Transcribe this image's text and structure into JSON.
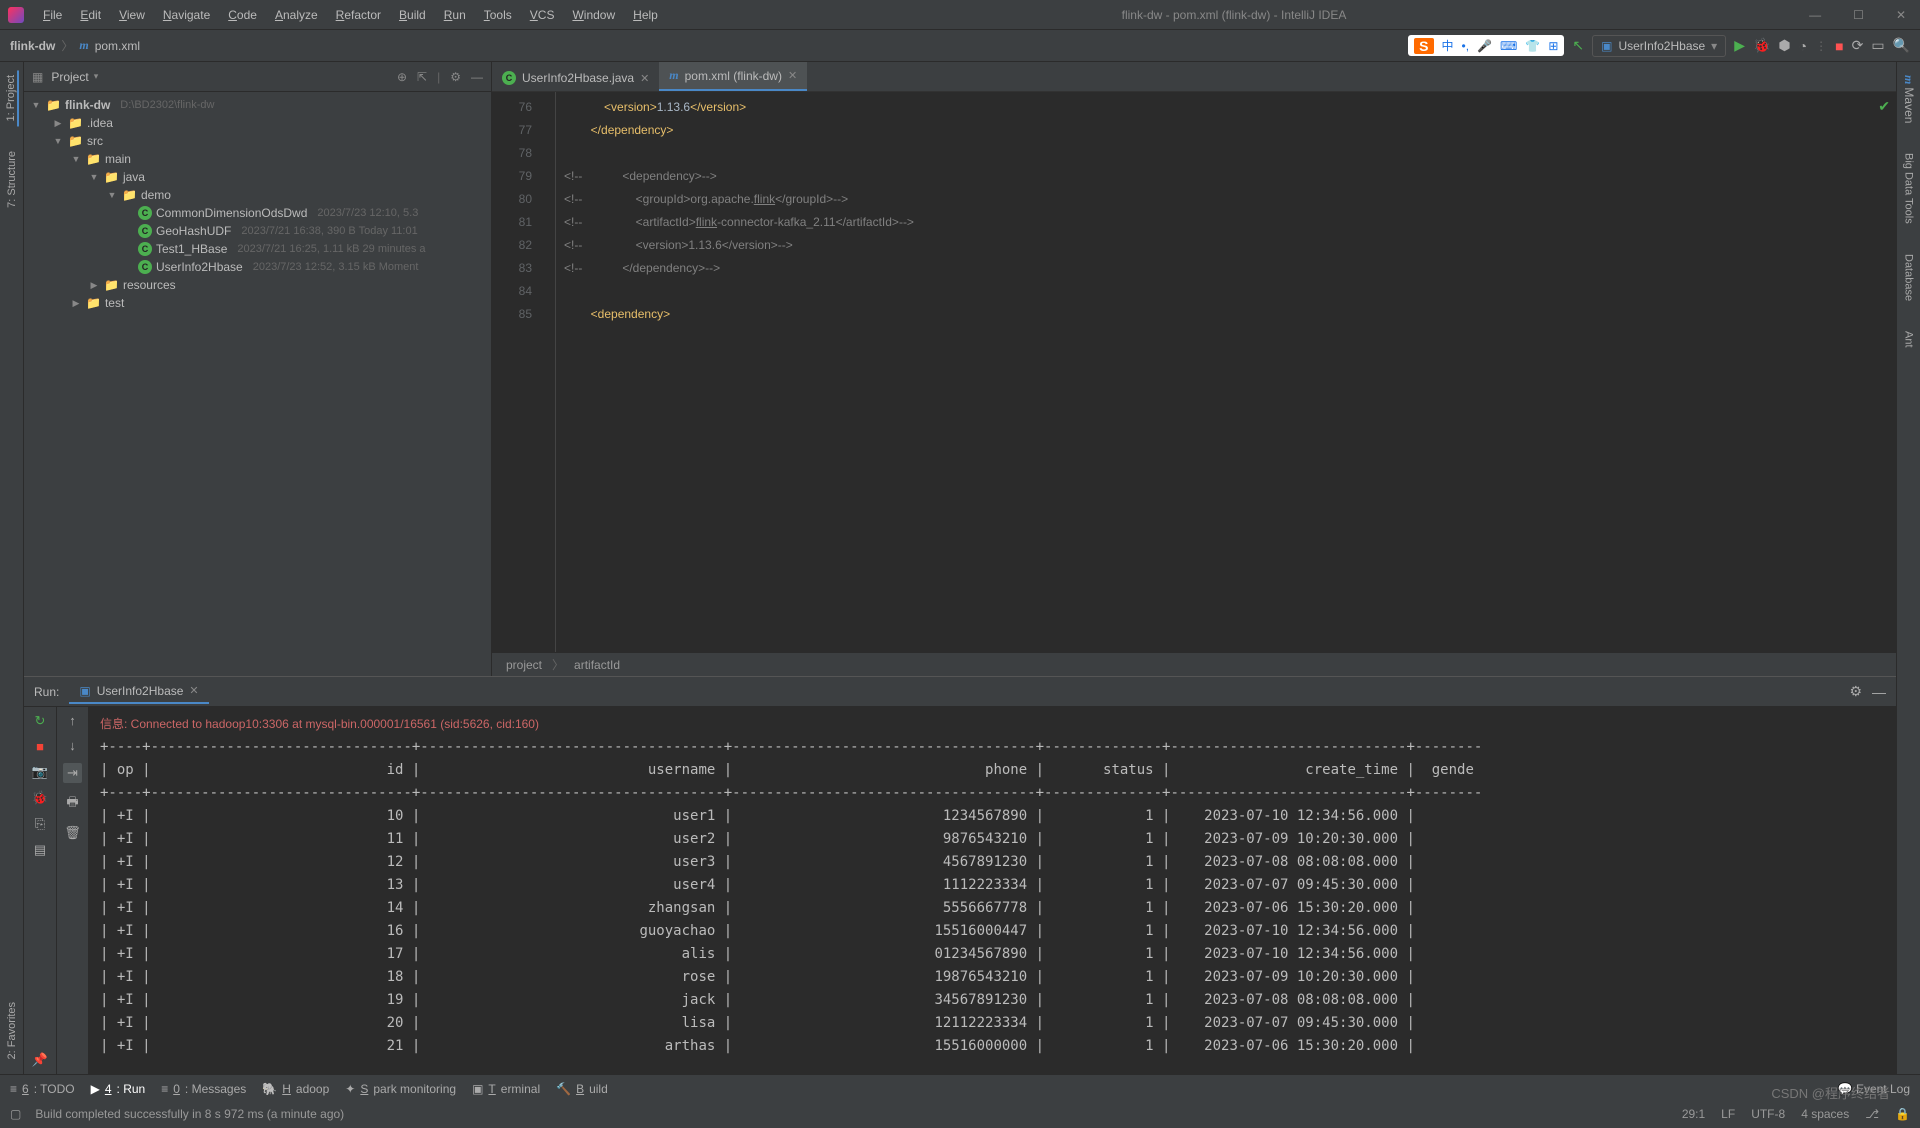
{
  "window": {
    "title": "flink-dw - pom.xml (flink-dw) - IntelliJ IDEA"
  },
  "menu": [
    "File",
    "Edit",
    "View",
    "Navigate",
    "Code",
    "Analyze",
    "Refactor",
    "Build",
    "Run",
    "Tools",
    "VCS",
    "Window",
    "Help"
  ],
  "breadcrumb": {
    "root": "flink-dw",
    "file": "pom.xml"
  },
  "run_config": "UserInfo2Hbase",
  "project_panel": {
    "title": "Project",
    "root": {
      "name": "flink-dw",
      "path": "D:\\BD2302\\flink-dw"
    },
    "idea": ".idea",
    "src": "src",
    "main": "main",
    "java": "java",
    "demo": "demo",
    "files": [
      {
        "name": "CommonDimensionOdsDwd",
        "meta": "2023/7/23 12:10, 5.3"
      },
      {
        "name": "GeoHashUDF",
        "meta": "2023/7/21 16:38, 390 B Today 11:01"
      },
      {
        "name": "Test1_HBase",
        "meta": "2023/7/21 16:25, 1.11 kB 29 minutes a"
      },
      {
        "name": "UserInfo2Hbase",
        "meta": "2023/7/23 12:52, 3.15 kB Moment"
      }
    ],
    "resources": "resources",
    "test": "test"
  },
  "editor": {
    "tabs": [
      {
        "label": "UserInfo2Hbase.java",
        "active": false,
        "icon": "c"
      },
      {
        "label": "pom.xml (flink-dw)",
        "active": true,
        "icon": "m"
      }
    ],
    "lines": [
      {
        "n": 76,
        "html": "            <span class='tag'>&lt;version&gt;</span>1.13.6<span class='tag'>&lt;/version&gt;</span>"
      },
      {
        "n": 77,
        "html": "        <span class='tag'>&lt;/dependency&gt;</span>"
      },
      {
        "n": 78,
        "html": ""
      },
      {
        "n": 79,
        "html": "<span class='comment'>&lt;!--            &lt;dependency&gt;--&gt;</span>"
      },
      {
        "n": 80,
        "html": "<span class='comment'>&lt;!--                &lt;groupId&gt;org.apache.<u>flink</u>&lt;/groupId&gt;--&gt;</span>"
      },
      {
        "n": 81,
        "html": "<span class='comment'>&lt;!--                &lt;artifactId&gt;<u>flink</u>-connector-kafka_2.11&lt;/artifactId&gt;--&gt;</span>"
      },
      {
        "n": 82,
        "html": "<span class='comment'>&lt;!--                &lt;version&gt;1.13.6&lt;/version&gt;--&gt;</span>"
      },
      {
        "n": 83,
        "html": "<span class='comment'>&lt;!--            &lt;/dependency&gt;--&gt;</span>"
      },
      {
        "n": 84,
        "html": ""
      },
      {
        "n": 85,
        "html": "        <span class='tag'>&lt;dependency&gt;</span>"
      }
    ],
    "crumb": [
      "project",
      "artifactId"
    ]
  },
  "run": {
    "title": "Run:",
    "tab": "UserInfo2Hbase",
    "info": "信息: Connected to hadoop10:3306 at mysql-bin.000001/16561 (sid:5626, cid:160)",
    "columns": [
      "op",
      "id",
      "username",
      "phone",
      "status",
      "create_time",
      "gende"
    ],
    "rows": [
      {
        "op": "+I",
        "id": "10",
        "username": "user1",
        "phone": "1234567890",
        "status": "1",
        "create_time": "2023-07-10 12:34:56.000"
      },
      {
        "op": "+I",
        "id": "11",
        "username": "user2",
        "phone": "9876543210",
        "status": "1",
        "create_time": "2023-07-09 10:20:30.000"
      },
      {
        "op": "+I",
        "id": "12",
        "username": "user3",
        "phone": "4567891230",
        "status": "1",
        "create_time": "2023-07-08 08:08:08.000"
      },
      {
        "op": "+I",
        "id": "13",
        "username": "user4",
        "phone": "1112223334",
        "status": "1",
        "create_time": "2023-07-07 09:45:30.000"
      },
      {
        "op": "+I",
        "id": "14",
        "username": "zhangsan",
        "phone": "5556667778",
        "status": "1",
        "create_time": "2023-07-06 15:30:20.000"
      },
      {
        "op": "+I",
        "id": "16",
        "username": "guoyachao",
        "phone": "15516000447",
        "status": "1",
        "create_time": "2023-07-10 12:34:56.000"
      },
      {
        "op": "+I",
        "id": "17",
        "username": "alis",
        "phone": "01234567890",
        "status": "1",
        "create_time": "2023-07-10 12:34:56.000"
      },
      {
        "op": "+I",
        "id": "18",
        "username": "rose",
        "phone": "19876543210",
        "status": "1",
        "create_time": "2023-07-09 10:20:30.000"
      },
      {
        "op": "+I",
        "id": "19",
        "username": "jack",
        "phone": "34567891230",
        "status": "1",
        "create_time": "2023-07-08 08:08:08.000"
      },
      {
        "op": "+I",
        "id": "20",
        "username": "lisa",
        "phone": "12112223334",
        "status": "1",
        "create_time": "2023-07-07 09:45:30.000"
      },
      {
        "op": "+I",
        "id": "21",
        "username": "arthas",
        "phone": "15516000000",
        "status": "1",
        "create_time": "2023-07-06 15:30:20.000"
      }
    ]
  },
  "bottom_tabs": [
    {
      "label": "6: TODO",
      "icon": "≡"
    },
    {
      "label": "4: Run",
      "icon": "▶",
      "active": true
    },
    {
      "label": "0: Messages",
      "icon": "≡"
    },
    {
      "label": "Hadoop",
      "icon": "🐘"
    },
    {
      "label": "Spark monitoring",
      "icon": "✦"
    },
    {
      "label": "Terminal",
      "icon": "▣"
    },
    {
      "label": "Build",
      "icon": "🔨"
    }
  ],
  "event_log": "Event Log",
  "status": {
    "msg": "Build completed successfully in 8 s 972 ms (a minute ago)",
    "pos": "29:1",
    "lf": "LF",
    "enc": "UTF-8",
    "indent": "4 spaces"
  },
  "watermark": "CSDN @程序终结者",
  "left_tabs": [
    "1: Project",
    "7: Structure"
  ],
  "left_bottom": "2: Favorites",
  "right_tabs": [
    "Maven",
    "Big Data Tools",
    "Database",
    "Ant"
  ],
  "ime": {
    "s": "S",
    "text": "中"
  }
}
